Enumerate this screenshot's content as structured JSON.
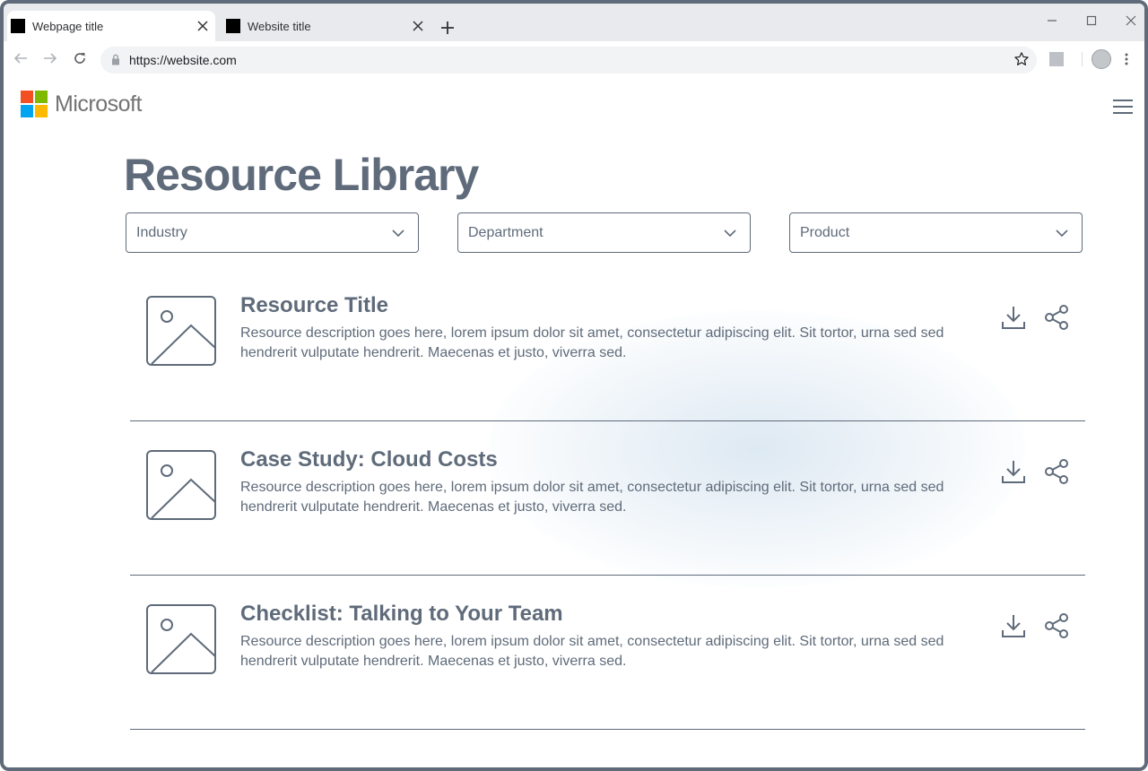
{
  "browser": {
    "tabs": [
      {
        "title": "Webpage title",
        "active": true
      },
      {
        "title": "Website title",
        "active": false
      }
    ],
    "url": "https://website.com"
  },
  "site": {
    "logo_text": "Microsoft",
    "logo_colors": [
      "#f25022",
      "#7fba00",
      "#00a4ef",
      "#ffb900"
    ]
  },
  "page": {
    "title": "Resource Library",
    "filters": [
      {
        "label": "Industry"
      },
      {
        "label": "Department"
      },
      {
        "label": "Product"
      }
    ],
    "resources": [
      {
        "title": "Resource Title",
        "description": "Resource description goes here, lorem ipsum dolor sit amet, consectetur adipiscing elit. Sit tortor, urna sed sed hendrerit vulputate hendrerit. Maecenas et justo, viverra sed."
      },
      {
        "title": "Case Study: Cloud Costs",
        "description": "Resource description goes here, lorem ipsum dolor sit amet, consectetur adipiscing elit. Sit tortor, urna sed sed hendrerit vulputate hendrerit. Maecenas et justo, viverra sed."
      },
      {
        "title": "Checklist: Talking to Your Team",
        "description": "Resource description goes here, lorem ipsum dolor sit amet, consectetur adipiscing elit. Sit tortor, urna sed sed hendrerit vulputate hendrerit. Maecenas et justo, viverra sed."
      }
    ]
  },
  "colors": {
    "text": "#5f6b7a",
    "window_frame": "#5f6b7a",
    "tabstrip": "#e8eaed",
    "omnibox": "#f1f3f4"
  },
  "icons": {
    "tab": "favicon",
    "tab_close": "close-icon",
    "new_tab": "plus-icon",
    "nav": [
      "back-arrow-icon",
      "forward-arrow-icon",
      "reload-icon"
    ],
    "omnibox": [
      "lock-icon",
      "star-icon"
    ],
    "menu": "hamburger-menu-icon",
    "filter": "chevron-down-icon",
    "resource": [
      "image-placeholder-icon",
      "download-icon",
      "share-icon"
    ]
  }
}
